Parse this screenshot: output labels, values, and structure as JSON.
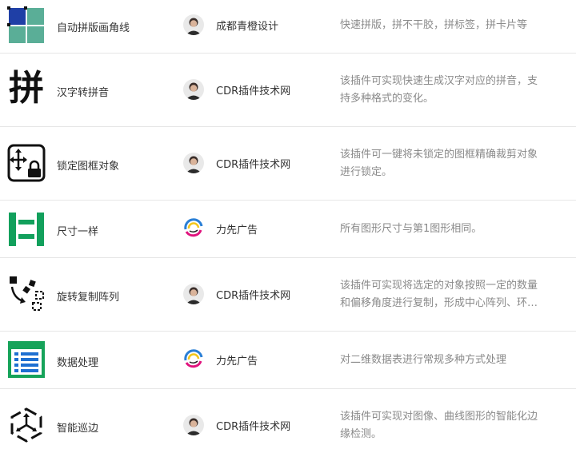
{
  "plugins": [
    {
      "name": "自动拼版画角线",
      "icon": "grid-squares-icon",
      "author": "成都青橙设计",
      "avatar": "person-avatar",
      "desc": "快速拼版，拼不干胶，拼标签，拼卡片等"
    },
    {
      "name": "汉字转拼音",
      "icon": "pin-character-icon",
      "icon_text": "拼",
      "author": "CDR插件技术网",
      "avatar": "person-avatar",
      "desc": "该插件可实现快速生成汉字对应的拼音，支持多种格式的变化。"
    },
    {
      "name": "锁定图框对象",
      "icon": "move-lock-icon",
      "author": "CDR插件技术网",
      "avatar": "person-avatar",
      "desc": "该插件可一键将未锁定的图框精确裁剪对象进行锁定。"
    },
    {
      "name": "尺寸一样",
      "icon": "same-size-icon",
      "author": "力先广告",
      "avatar": "swirl-logo-avatar",
      "desc": "所有图形尺寸与第1图形相同。"
    },
    {
      "name": "旋转复制阵列",
      "icon": "rotate-copy-array-icon",
      "author": "CDR插件技术网",
      "avatar": "person-avatar",
      "desc": "该插件可实现将选定的对象按照一定的数量和偏移角度进行复制，形成中心阵列、环形阵列等。"
    },
    {
      "name": "数据处理",
      "icon": "data-table-icon",
      "author": "力先广告",
      "avatar": "swirl-logo-avatar",
      "desc": "对二维数据表进行常规多种方式处理"
    },
    {
      "name": "智能巡边",
      "icon": "smart-edge-icon",
      "author": "CDR插件技术网",
      "avatar": "person-avatar",
      "desc": "该插件可实现对图像、曲线图形的智能化边缘检测。"
    }
  ]
}
